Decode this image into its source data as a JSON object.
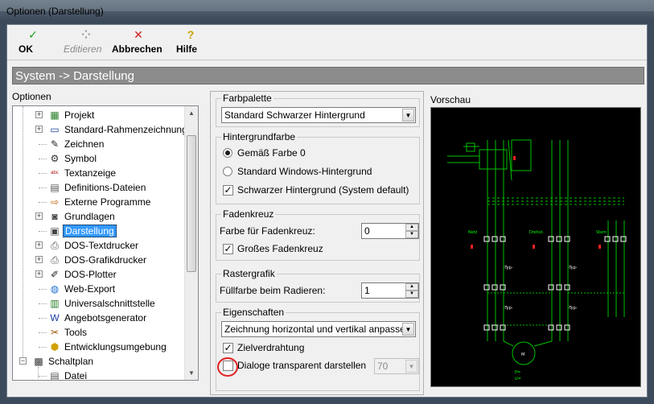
{
  "window": {
    "title": "Optionen (Darstellung)"
  },
  "toolbar": {
    "ok": "OK",
    "edit": "Editieren",
    "cancel": "Abbrechen",
    "help": "Hilfe"
  },
  "header": {
    "path": "System -> Darstellung"
  },
  "options_label": "Optionen",
  "tree": {
    "items": [
      {
        "label": "Projekt",
        "icon": "project-icon",
        "expandable": true,
        "level": 1
      },
      {
        "label": "Standard-Rahmenzeichnungen",
        "icon": "frame-icon",
        "expandable": true,
        "level": 1
      },
      {
        "label": "Zeichnen",
        "icon": "draw-icon",
        "expandable": false,
        "level": 1
      },
      {
        "label": "Symbol",
        "icon": "symbol-icon",
        "expandable": false,
        "level": 1
      },
      {
        "label": "Textanzeige",
        "icon": "text-icon",
        "expandable": false,
        "level": 1
      },
      {
        "label": "Definitions-Dateien",
        "icon": "document-icon",
        "expandable": false,
        "level": 1
      },
      {
        "label": "Externe Programme",
        "icon": "external-icon",
        "expandable": false,
        "level": 1
      },
      {
        "label": "Grundlagen",
        "icon": "basics-icon",
        "expandable": true,
        "level": 1
      },
      {
        "label": "Darstellung",
        "icon": "display-icon",
        "expandable": false,
        "level": 1,
        "selected": true
      },
      {
        "label": "DOS-Textdrucker",
        "icon": "printer-icon",
        "expandable": true,
        "level": 1
      },
      {
        "label": "DOS-Grafikdrucker",
        "icon": "printer-icon",
        "expandable": true,
        "level": 1
      },
      {
        "label": "DOS-Plotter",
        "icon": "plotter-icon",
        "expandable": true,
        "level": 1
      },
      {
        "label": "Web-Export",
        "icon": "globe-icon",
        "expandable": false,
        "level": 1
      },
      {
        "label": "Universalschnittstelle",
        "icon": "interface-icon",
        "expandable": false,
        "level": 1
      },
      {
        "label": "Angebotsgenerator",
        "icon": "word-icon",
        "expandable": false,
        "level": 1
      },
      {
        "label": "Tools",
        "icon": "tools-icon",
        "expandable": false,
        "level": 1
      },
      {
        "label": "Entwicklungsumgebung",
        "icon": "dev-icon",
        "expandable": false,
        "level": 1
      },
      {
        "label": "Schaltplan",
        "icon": "schematic-icon",
        "expandable": true,
        "expanded": true,
        "level": 0
      },
      {
        "label": "Datei",
        "icon": "document-icon",
        "expandable": false,
        "level": 1
      }
    ]
  },
  "palette": {
    "legend": "Farbpalette",
    "value": "Standard Schwarzer Hintergrund"
  },
  "background": {
    "legend": "Hintergrundfarbe",
    "radio1": "Gemäß Farbe 0",
    "radio2": "Standard Windows-Hintergrund",
    "check": "Schwarzer Hintergrund (System default)"
  },
  "crosshair": {
    "legend": "Fadenkreuz",
    "color_label": "Farbe für Fadenkreuz:",
    "color_value": "0",
    "big_label": "Großes Fadenkreuz"
  },
  "raster": {
    "legend": "Rastergrafik",
    "fill_label": "Füllfarbe beim Radieren:",
    "fill_value": "1"
  },
  "properties": {
    "legend": "Eigenschaften",
    "fit_value": "Zeichnung horizontal und vertikal anpassen",
    "target_wiring": "Zielverdrahtung",
    "transparent": "Dialoge transparent darstellen",
    "transparent_value": "70"
  },
  "preview": {
    "label": "Vorschau",
    "netz": "Netz",
    "drehst": "Drehst.",
    "stern": "Stern",
    "motor": "M"
  }
}
